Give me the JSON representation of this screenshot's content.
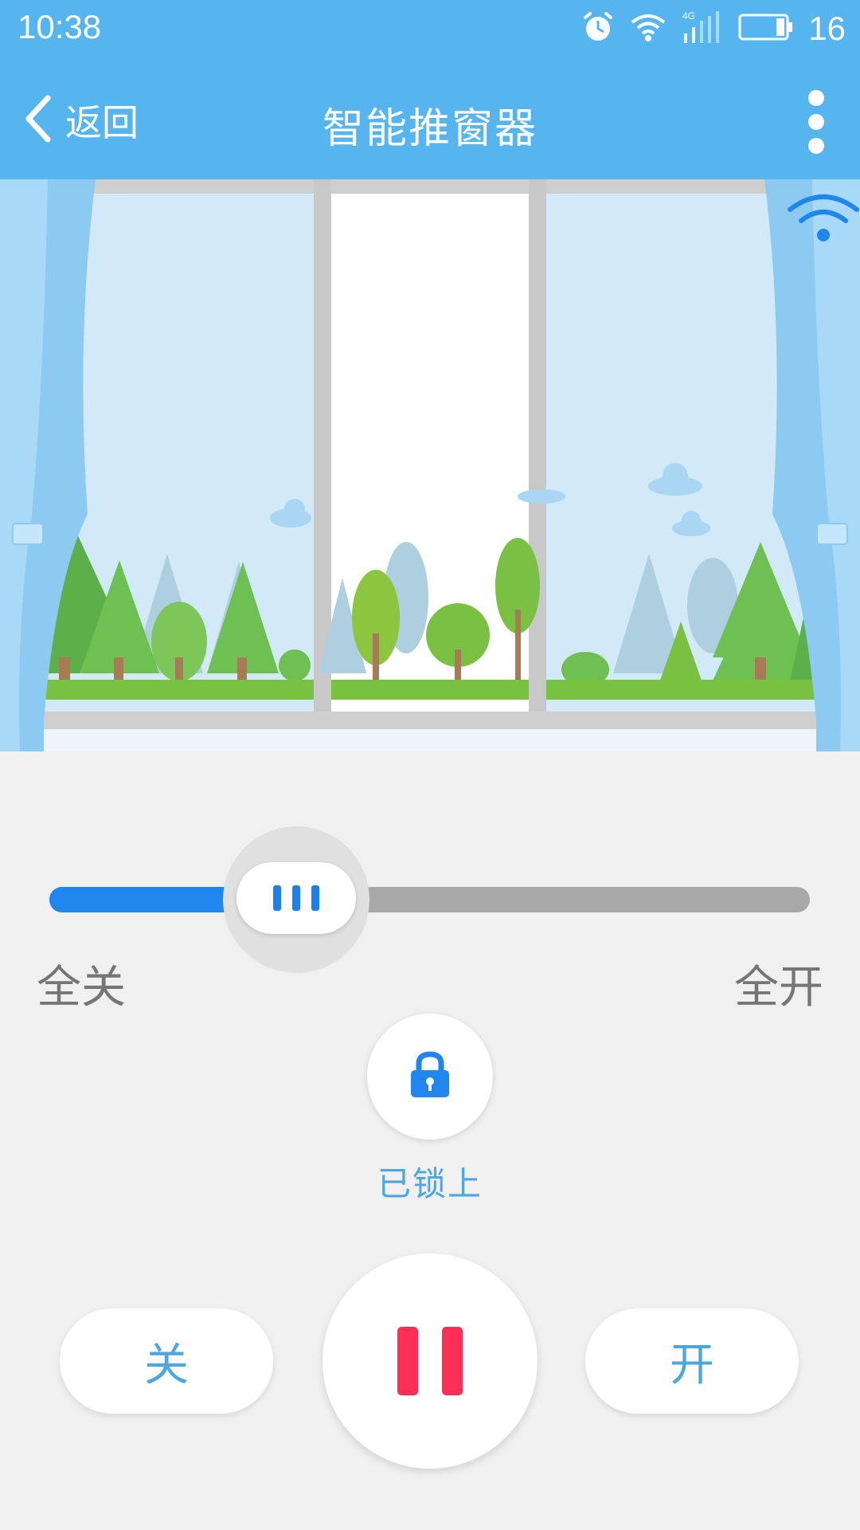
{
  "status_bar": {
    "time": "10:38",
    "battery_level": "16"
  },
  "nav": {
    "back_label": "返回",
    "title": "智能推窗器"
  },
  "slider": {
    "min_label": "全关",
    "max_label": "全开",
    "value": 0.26
  },
  "lock": {
    "status": "已锁上"
  },
  "controls": {
    "close_label": "关",
    "open_label": "开"
  },
  "colors": {
    "header": "#56b5ef",
    "accent": "#1f86ee",
    "pause": "#ff2e57",
    "text_blue": "#4da7df"
  }
}
